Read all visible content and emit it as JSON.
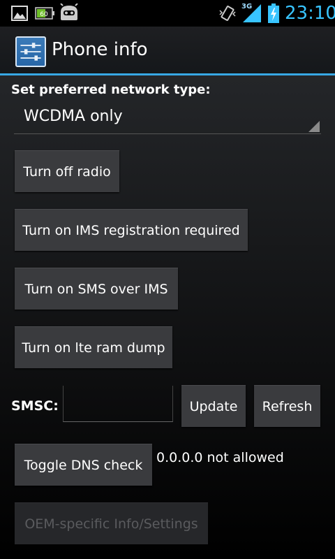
{
  "status_bar": {
    "battery_notification": "60",
    "network": "3G",
    "time": "23:10",
    "icons": [
      "gallery-icon",
      "battery-notification-icon",
      "cyanogen-icon",
      "vibrate-icon",
      "signal-icon",
      "battery-charging-icon"
    ]
  },
  "action_bar": {
    "title": "Phone info",
    "icon": "settings-sliders-icon",
    "accent_color": "#37a8e4"
  },
  "network_type": {
    "label": "Set preferred network type:",
    "selected": "WCDMA only"
  },
  "buttons": {
    "radio": "Turn off radio",
    "ims": "Turn on IMS registration required",
    "sms_over_ims": "Turn on SMS over IMS",
    "lte_dump": "Turn on lte ram dump",
    "update": "Update",
    "refresh": "Refresh",
    "dns": "Toggle DNS check",
    "oem": "OEM-specific Info/Settings"
  },
  "smsc": {
    "label": "SMSC:",
    "value": ""
  },
  "dns_status": "0.0.0.0 not allowed"
}
